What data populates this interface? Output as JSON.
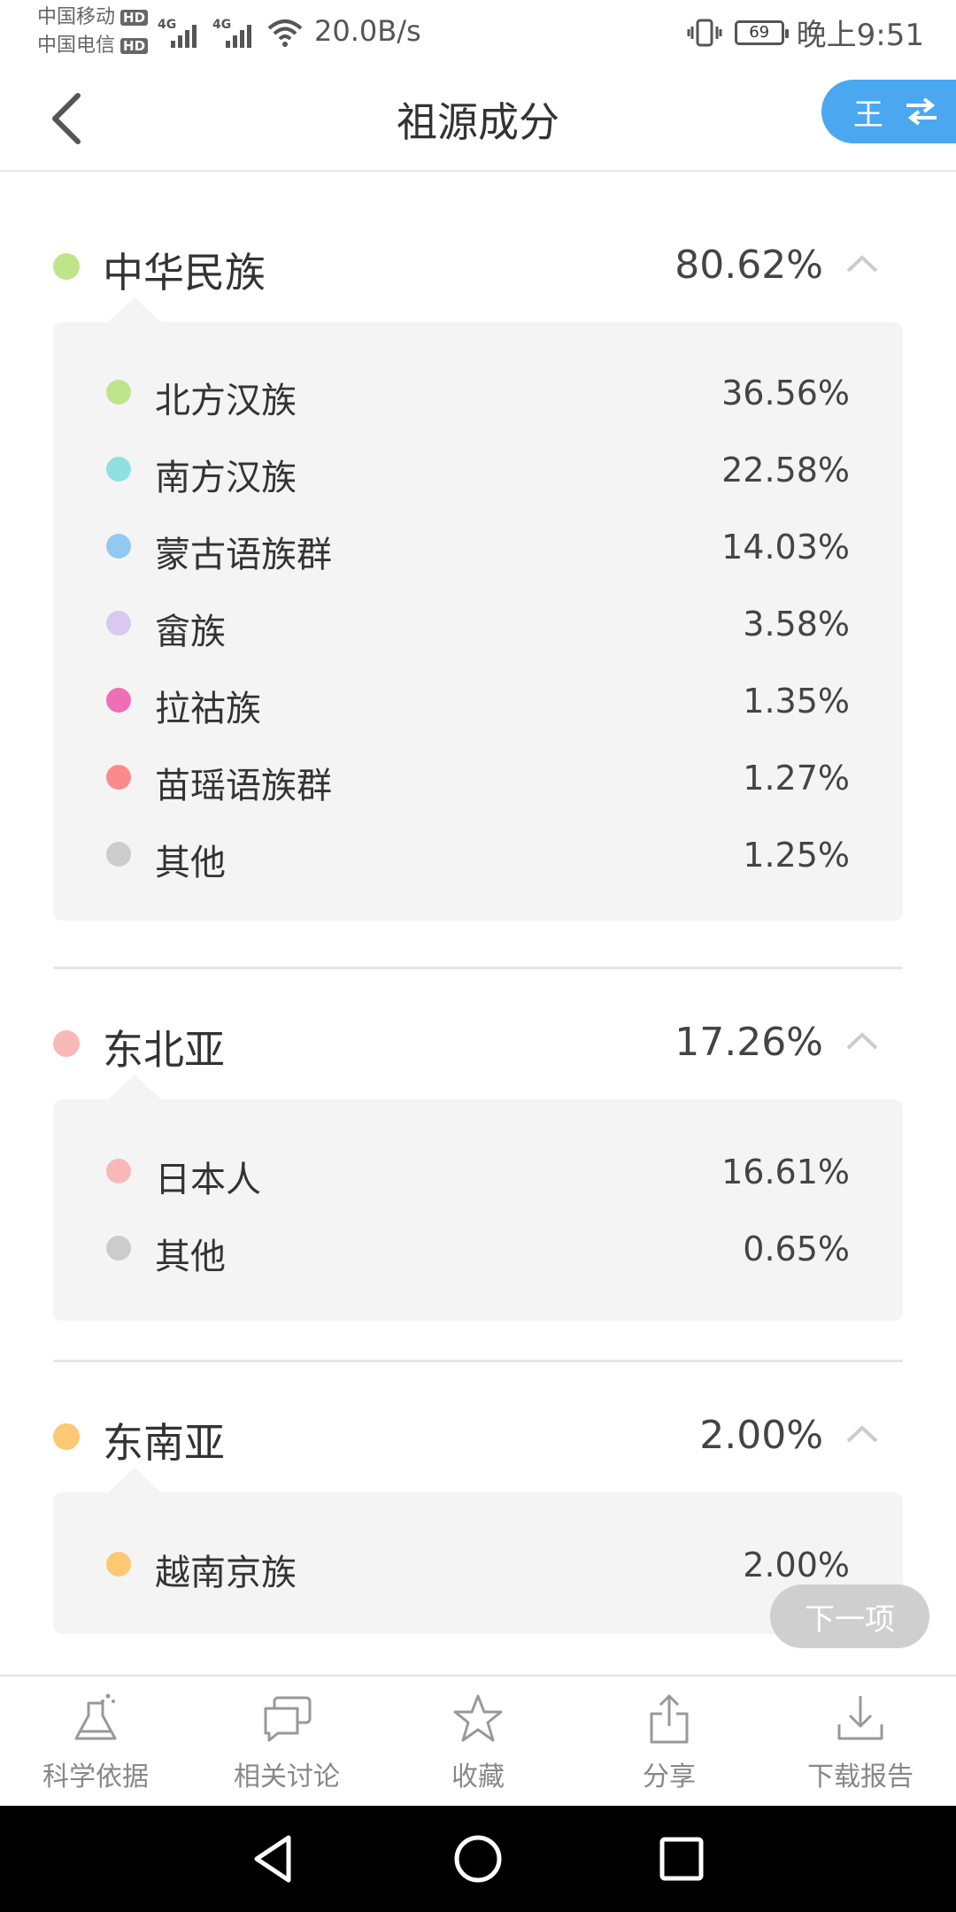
{
  "status": {
    "carrier1": "中国移动",
    "carrier2": "中国电信",
    "hd": "HD",
    "signal_label": "4G",
    "net_speed": "20.0B/s",
    "battery": "69",
    "time": "晚上9:51"
  },
  "header": {
    "title": "祖源成分",
    "switch_label": "王"
  },
  "groups": [
    {
      "name": "中华民族",
      "percent": "80.62%",
      "color": "#bfe58a",
      "items": [
        {
          "name": "北方汉族",
          "percent": "36.56%",
          "color": "#bfe58a"
        },
        {
          "name": "南方汉族",
          "percent": "22.58%",
          "color": "#8fe0e0"
        },
        {
          "name": "蒙古语族群",
          "percent": "14.03%",
          "color": "#92c9f2"
        },
        {
          "name": "畲族",
          "percent": "3.58%",
          "color": "#d8c9ee"
        },
        {
          "name": "拉祜族",
          "percent": "1.35%",
          "color": "#ee6fb4"
        },
        {
          "name": "苗瑶语族群",
          "percent": "1.27%",
          "color": "#fb8a8a"
        },
        {
          "name": "其他",
          "percent": "1.25%",
          "color": "#cccccc"
        }
      ]
    },
    {
      "name": "东北亚",
      "percent": "17.26%",
      "color": "#f9b8b8",
      "items": [
        {
          "name": "日本人",
          "percent": "16.61%",
          "color": "#f9b8b8"
        },
        {
          "name": "其他",
          "percent": "0.65%",
          "color": "#cccccc"
        }
      ]
    },
    {
      "name": "东南亚",
      "percent": "2.00%",
      "color": "#fcc873",
      "items": [
        {
          "name": "越南京族",
          "percent": "2.00%",
          "color": "#fcc873"
        }
      ]
    }
  ],
  "next_button": "下一项",
  "toolbar": [
    {
      "label": "科学依据",
      "icon": "flask-icon"
    },
    {
      "label": "相关讨论",
      "icon": "chat-icon"
    },
    {
      "label": "收藏",
      "icon": "star-icon"
    },
    {
      "label": "分享",
      "icon": "share-icon"
    },
    {
      "label": "下载报告",
      "icon": "download-icon"
    }
  ]
}
